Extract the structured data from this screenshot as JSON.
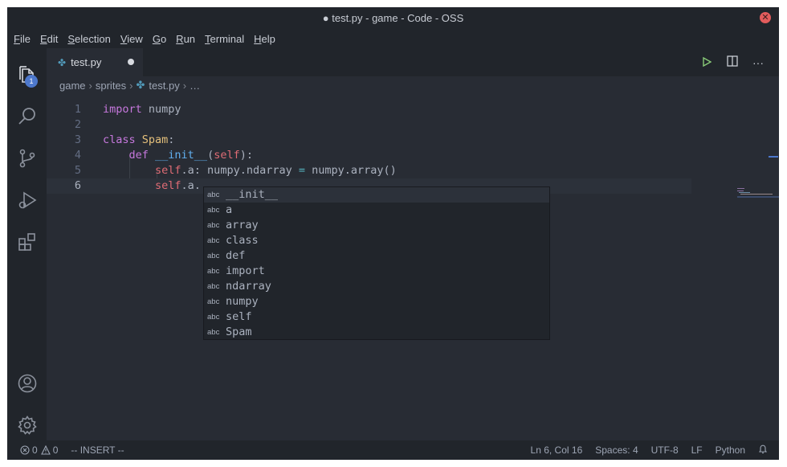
{
  "window": {
    "title": "● test.py - game - Code - OSS",
    "close_icon": "close-icon"
  },
  "menu": [
    {
      "mn": "F",
      "rest": "ile"
    },
    {
      "mn": "E",
      "rest": "dit"
    },
    {
      "mn": "S",
      "rest": "election"
    },
    {
      "mn": "V",
      "rest": "iew"
    },
    {
      "mn": "G",
      "rest": "o"
    },
    {
      "mn": "R",
      "rest": "un"
    },
    {
      "mn": "T",
      "rest": "erminal"
    },
    {
      "mn": "H",
      "rest": "elp"
    }
  ],
  "activity": {
    "explorer_badge": "1"
  },
  "tab": {
    "label": "test.py"
  },
  "breadcrumb": {
    "part1": "game",
    "part2": "sprites",
    "file": "test.py",
    "more": "…"
  },
  "editor": {
    "lines": [
      {
        "n": "1"
      },
      {
        "n": "2"
      },
      {
        "n": "3"
      },
      {
        "n": "4"
      },
      {
        "n": "5"
      },
      {
        "n": "6"
      }
    ],
    "tokens": {
      "import": "import",
      "numpy": " numpy",
      "class": "class",
      "spam": " Spam",
      "colon": ":",
      "def": "def",
      "init": " __init__",
      "paren_open": "(",
      "self": "self",
      "paren_close": "):",
      "self_a": "self",
      "dot_a": ".a: numpy.ndarray ",
      "eq": "=",
      "rhs": " numpy.array()",
      "self6": "self",
      "dot6": ".a."
    }
  },
  "suggest": {
    "kind": "abc",
    "items": [
      "__init__",
      "a",
      "array",
      "class",
      "def",
      "import",
      "ndarray",
      "numpy",
      "self",
      "Spam"
    ]
  },
  "status": {
    "errors": "0",
    "warnings": "0",
    "mode": "-- INSERT --",
    "position": "Ln 6, Col 16",
    "spaces": "Spaces: 4",
    "encoding": "UTF-8",
    "eol": "LF",
    "language": "Python"
  }
}
